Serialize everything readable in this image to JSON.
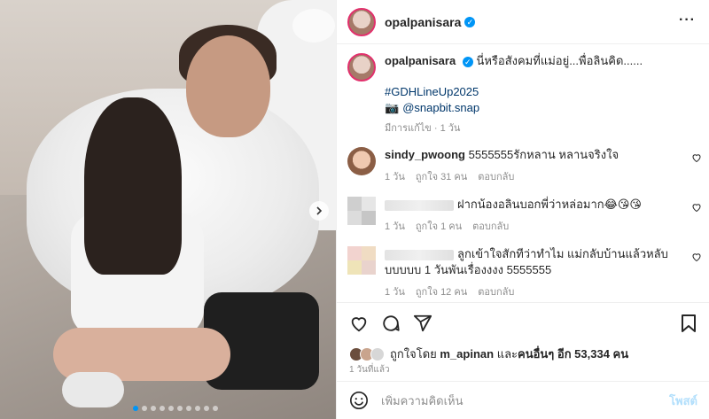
{
  "post": {
    "username": "opalpanisara",
    "caption_text": "นี่หรือสังคมที่แม่อยู่...พื่อลินคิด......",
    "hashtag": "#GDHLineUp2025",
    "credit": "@snapbit.snap",
    "edited_label": "มีการแก้ไข · 1 วัน"
  },
  "comments": [
    {
      "username": "sindy_pwoong",
      "text": "5555555รักหลาน หลานจริงใจ",
      "time": "1 วัน",
      "likes": "ถูกใจ 31 คน",
      "reply": "ตอบกลับ"
    },
    {
      "username": "",
      "text": "ฝากน้องอลินบอกพี่ว่าหล่อมาก😂😘😘",
      "time": "1 วัน",
      "likes": "ถูกใจ 1 คน",
      "reply": "ตอบกลับ"
    },
    {
      "username": "",
      "text": "ลูกเข้าใจสักทีว่าทำไม แม่กลับบ้านแล้วหลับบบบบบ 1 วันพันเรื่องงงง 5555555",
      "time": "1 วัน",
      "likes": "ถูกใจ 12 คน",
      "reply": "ตอบกลับ"
    }
  ],
  "likes_bar": {
    "prefix": "ถูกใจโดย",
    "liked_by": "m_apinan",
    "middle": "และ",
    "others": "คนอื่นๆ อีก 53,334 คน"
  },
  "post_time": "1 วันที่แล้ว",
  "add_comment": {
    "placeholder": "เพิ่มความคิดเห็น",
    "post_label": "โพสต์"
  },
  "colors": {
    "accent": "#0095f6",
    "link": "#00376b",
    "muted": "#8e8e8e",
    "post_disabled": "#b2dffc"
  },
  "icons": [
    "verified-icon",
    "more-icon",
    "heart-icon",
    "comment-icon",
    "share-icon",
    "save-icon",
    "emoji-icon",
    "camera-icon",
    "chevron-right-icon"
  ]
}
